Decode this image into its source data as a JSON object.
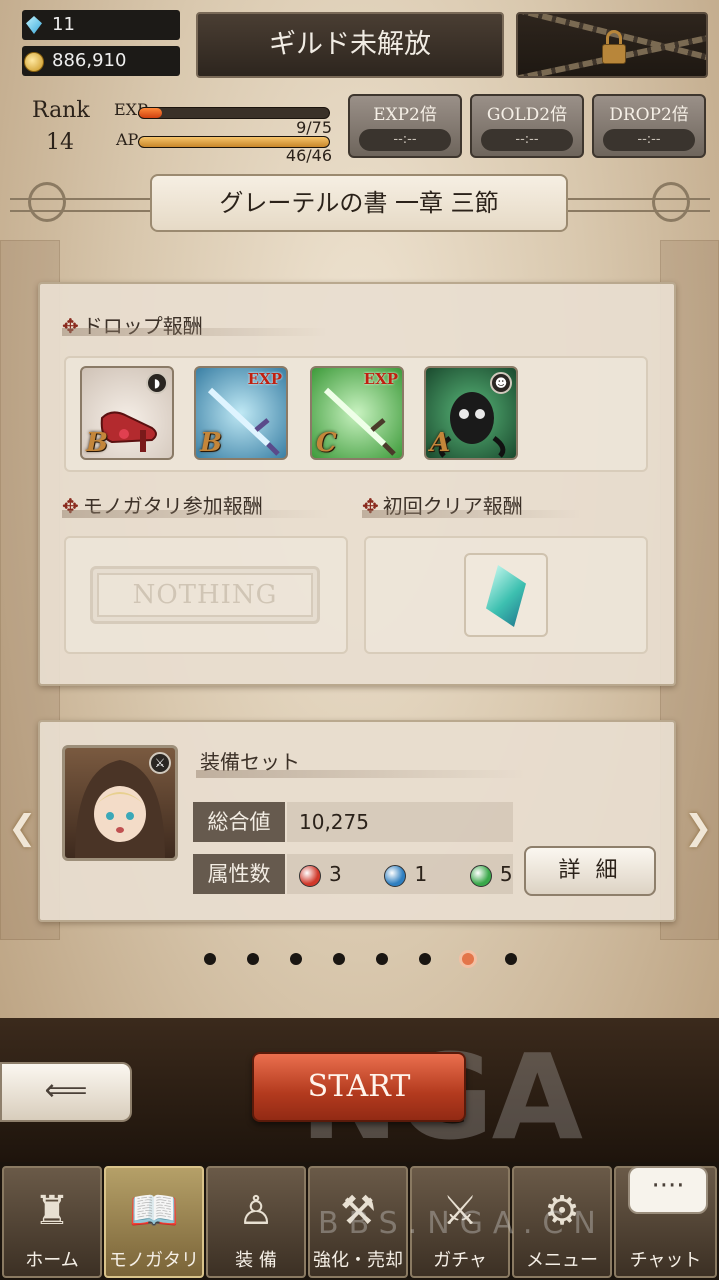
{
  "resources": {
    "gems": "11",
    "gold": "886,910"
  },
  "header": {
    "guild_label": "ギルド未解放",
    "rank_label": "Rank",
    "rank_value": "14",
    "exp_label": "EXP",
    "exp_value": "9/75",
    "exp_progress": 0.12,
    "ap_label": "AP",
    "ap_value": "46/46",
    "ap_progress": 1.0
  },
  "boosts": [
    {
      "label": "EXP2倍",
      "timer": "--:--"
    },
    {
      "label": "GOLD2倍",
      "timer": "--:--"
    },
    {
      "label": "DROP2倍",
      "timer": "--:--"
    }
  ],
  "stage_title": "グレーテルの書 一章 三節",
  "rewards": {
    "drop_heading": "ドロップ報酬",
    "drops": [
      {
        "rank": "B",
        "tag": "",
        "icon": "red-shoes-icon"
      },
      {
        "rank": "B",
        "tag": "EXP",
        "icon": "blue-sword-icon"
      },
      {
        "rank": "C",
        "tag": "EXP",
        "icon": "green-sword-icon"
      },
      {
        "rank": "A",
        "tag": "",
        "icon": "dark-creature-icon"
      }
    ],
    "participation_heading": "モノガタリ参加報酬",
    "participation_value": "NOTHING",
    "first_clear_heading": "初回クリア報酬",
    "first_clear_icon": "crystal-icon"
  },
  "equipment": {
    "title": "装備セット",
    "total_label": "総合値",
    "total_value": "10,275",
    "attr_label": "属性数",
    "attributes": [
      {
        "color": "#d0382a",
        "count": "3"
      },
      {
        "color": "#2f7fc0",
        "count": "1"
      },
      {
        "color": "#3aa84a",
        "count": "5"
      }
    ],
    "detail_label": "詳 細"
  },
  "pager": {
    "count": 8,
    "active_index": 6
  },
  "start_label": "START",
  "watermark": {
    "logo": "NGA",
    "url": "BBS.NGA.CN"
  },
  "tabs": [
    {
      "label": "ホーム",
      "icon": "castle-icon"
    },
    {
      "label": "モノガタリ",
      "icon": "book-icon"
    },
    {
      "label": "装 備",
      "icon": "puppet-icon"
    },
    {
      "label": "強化・売却",
      "icon": "anvil-icon"
    },
    {
      "label": "ガチャ",
      "icon": "crossed-swords-icon"
    },
    {
      "label": "メニュー",
      "icon": "gears-icon"
    },
    {
      "label": "チャット",
      "icon": "chat-icon"
    }
  ],
  "chat_bubble": "····"
}
